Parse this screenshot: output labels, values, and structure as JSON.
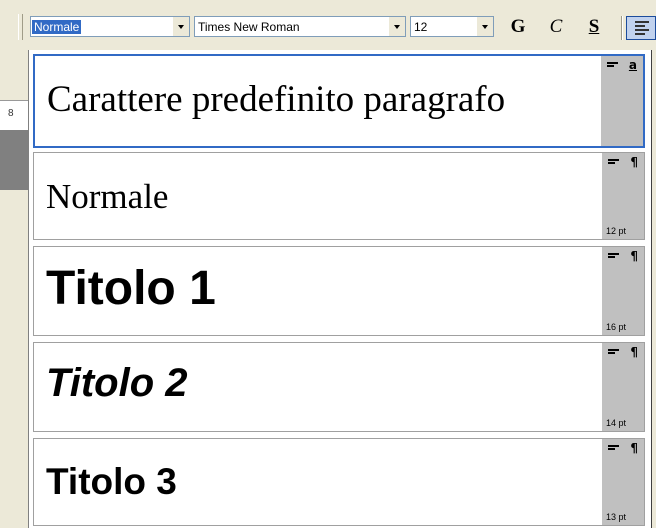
{
  "toolbar": {
    "style_value": "Normale",
    "font_value": "Times New Roman",
    "size_value": "12",
    "bold_label": "G",
    "italic_label": "C",
    "underline_label": "S"
  },
  "document": {
    "ruler_number": "8"
  },
  "styles": [
    {
      "name": "Carattere predefinito paragrafo",
      "type_icon": "a",
      "size": ""
    },
    {
      "name": "Normale",
      "type_icon": "¶",
      "size": "12 pt"
    },
    {
      "name": "Titolo 1",
      "type_icon": "¶",
      "size": "16 pt"
    },
    {
      "name": "Titolo 2",
      "type_icon": "¶",
      "size": "14 pt"
    },
    {
      "name": "Titolo 3",
      "type_icon": "¶",
      "size": "13 pt"
    }
  ],
  "colors": {
    "selection": "#316ac5",
    "toolbar_bg": "#ece9d8",
    "sidebar_bg": "#c0c0c0"
  },
  "icons": [
    "chevron-down-icon",
    "align-left-icon",
    "character-style-icon",
    "paragraph-style-icon"
  ]
}
